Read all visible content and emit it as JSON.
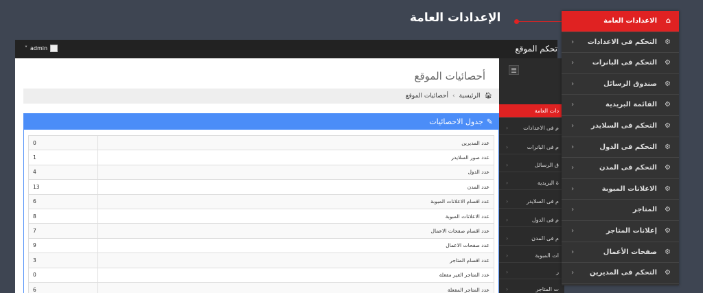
{
  "header": {
    "brand": "تحكم الموقع",
    "user": "admin",
    "user_caret": "˅"
  },
  "page": {
    "title": "أحصائيات الموقع",
    "heading": "الإعدادات العامة"
  },
  "breadcrumb": {
    "home": "الرئيسية",
    "separator": "›",
    "current": "أحصائيات الموقع",
    "home_icon": "🏠︎"
  },
  "panel": {
    "title": "جدول الاحصائيات",
    "icon": "✎"
  },
  "stats": [
    {
      "label": "عدد المديرين",
      "value": "0"
    },
    {
      "label": "عدد صور السلايدر",
      "value": "1"
    },
    {
      "label": "عدد الدول",
      "value": "4"
    },
    {
      "label": "عدد المدن",
      "value": "13"
    },
    {
      "label": "عدد اقسام الاعلانات المبوبة",
      "value": "6"
    },
    {
      "label": "عدد الاعلانات المبوبة",
      "value": "8"
    },
    {
      "label": "عدد اقسام صفحات الاعمال",
      "value": "7"
    },
    {
      "label": "عدد صفحات الاعمال",
      "value": "9"
    },
    {
      "label": "عدد اقسام المتاجر",
      "value": "3"
    },
    {
      "label": "عدد المتاجر الغير مفعلة",
      "value": "0"
    },
    {
      "label": "عدد المتاجر المفعلة",
      "value": "6"
    }
  ],
  "sidebar": {
    "items": [
      {
        "label": "دات العامة",
        "active": true
      },
      {
        "label": "م فى الاعدادات"
      },
      {
        "label": "م فى البانرات"
      },
      {
        "label": "ق الرسائل"
      },
      {
        "label": "ة البريدية"
      },
      {
        "label": "م فى السلايدر"
      },
      {
        "label": "م فى الدول"
      },
      {
        "label": "م فى المدن"
      },
      {
        "label": "ات المبوبة"
      },
      {
        "label": "ر"
      },
      {
        "label": "ت المتاجر"
      }
    ]
  },
  "menu": {
    "chevron": "‹",
    "items": [
      {
        "label": "الاعدادات العامة",
        "icon": "home-icon",
        "glyph": "⌂",
        "active": true
      },
      {
        "label": "التحكم فى الاعدادات",
        "icon": "gears-icon",
        "glyph": "⚙"
      },
      {
        "label": "التحكم فى البانرات",
        "icon": "gears-icon",
        "glyph": "⚙"
      },
      {
        "label": "صندوق الرسائل",
        "icon": "gears-icon",
        "glyph": "⚙"
      },
      {
        "label": "القائمة البريدية",
        "icon": "gears-icon",
        "glyph": "⚙"
      },
      {
        "label": "التحكم فى السلايدر",
        "icon": "gears-icon",
        "glyph": "⚙"
      },
      {
        "label": "التحكم فى الدول",
        "icon": "gears-icon",
        "glyph": "⚙"
      },
      {
        "label": "التحكم فى المدن",
        "icon": "gears-icon",
        "glyph": "⚙"
      },
      {
        "label": "الاعلانات المبوبة",
        "icon": "gears-icon",
        "glyph": "⚙"
      },
      {
        "label": "المتاجر",
        "icon": "gears-icon",
        "glyph": "⚙"
      },
      {
        "label": "إعلانات المتاجر",
        "icon": "gears-icon",
        "glyph": "⚙"
      },
      {
        "label": "صفحات الأعمال",
        "icon": "gears-icon",
        "glyph": "⚙"
      },
      {
        "label": "التحكم فى المديرين",
        "icon": "gears-icon",
        "glyph": "⚙"
      }
    ]
  },
  "colors": {
    "accent": "#e02222",
    "panel": "#4b8df8",
    "background": "#3e4552"
  }
}
